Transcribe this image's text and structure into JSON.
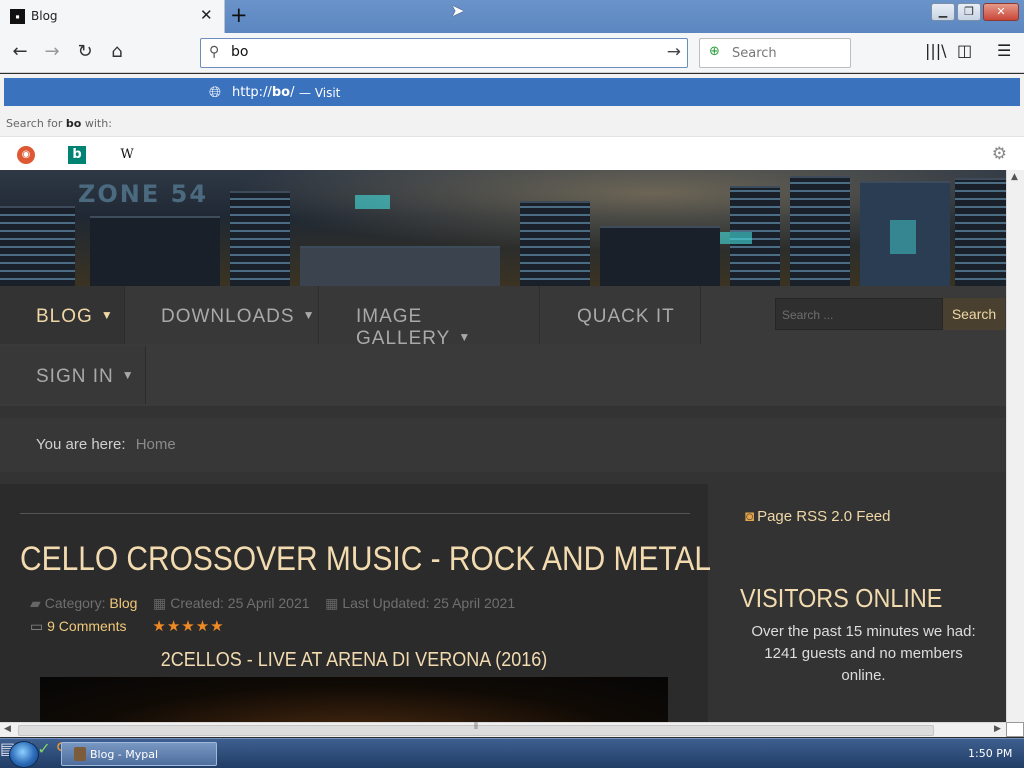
{
  "browser": {
    "tab_title": "Blog",
    "tab_close": "✕",
    "new_tab": "+",
    "url_value": "bo",
    "search_placeholder": "Search",
    "suggestion_url_prefix": "http://",
    "suggestion_url_bold": "bo",
    "suggestion_url_suffix": "/",
    "suggestion_action": "— Visit",
    "search_for_prefix": "Search for ",
    "search_for_term": "bo",
    "search_for_suffix": " with:",
    "engines": [
      "DuckDuckGo",
      "Bing",
      "Wikipedia"
    ],
    "engine_wiki_glyph": "W",
    "engine_bing_glyph": "b"
  },
  "site": {
    "logo_text": "ZONE 54",
    "menu": [
      {
        "label": "BLOG",
        "has_caret": true
      },
      {
        "label": "DOWNLOADS",
        "has_caret": true
      },
      {
        "label": "IMAGE GALLERY",
        "has_caret": true
      },
      {
        "label": "QUACK IT",
        "has_caret": false
      },
      {
        "label": "SIGN IN",
        "has_caret": true
      }
    ],
    "search_placeholder": "Search ...",
    "search_button": "Search",
    "breadcrumb_label": "You are here:",
    "breadcrumb_home": "Home"
  },
  "article": {
    "title": "CELLO CROSSOVER MUSIC - ROCK AND METAL",
    "category_label": "Category:",
    "category": "Blog",
    "created": "Created: 25 April 2021",
    "updated": "Last Updated: 25 April 2021",
    "comments": "9 Comments",
    "rating_stars": 5,
    "stars_text": "★★★★★",
    "video_title": "2CELLOS - LIVE AT ARENA DI VERONA (2016)"
  },
  "sidebar": {
    "rss_label": "Page RSS 2.0 Feed",
    "visitors_heading": "VISITORS ONLINE",
    "visitors_text": "Over the past 15 minutes we had: 1241 guests and no members online."
  },
  "taskbar": {
    "window_label": "Blog - Mypal",
    "clock": "1:50 PM"
  }
}
